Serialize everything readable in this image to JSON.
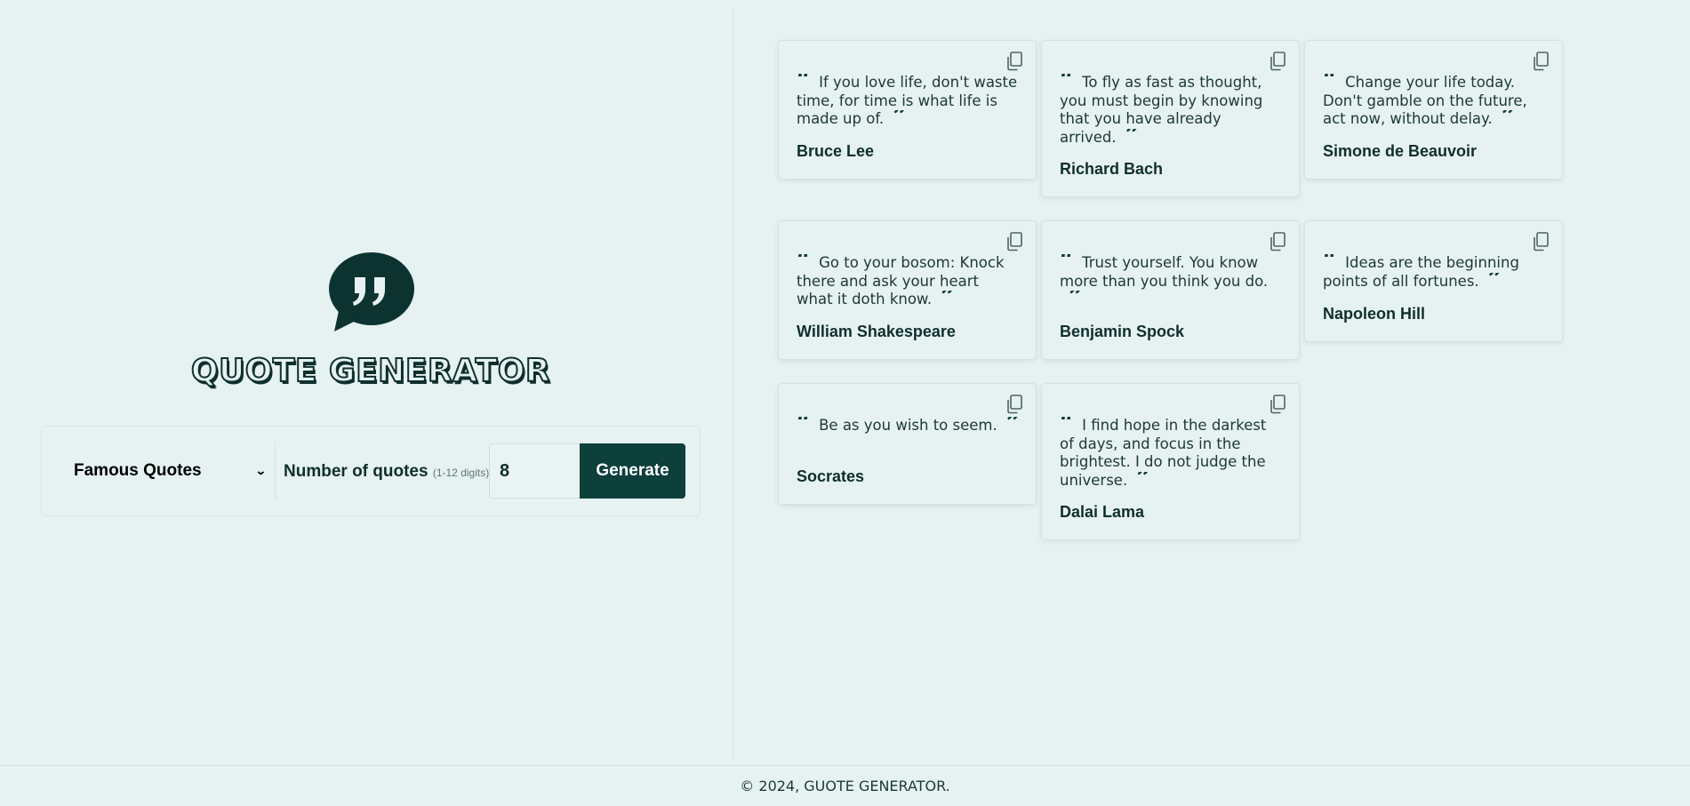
{
  "app": {
    "title": "QUOTE GENERATOR"
  },
  "controls": {
    "category": "Famous Quotes",
    "count_label": "Number of quotes",
    "count_hint": "(1-12 digits)",
    "count_value": "8",
    "generate_label": "Generate"
  },
  "quotes": [
    {
      "text": "If you love life, don't waste time, for time is what life is made up of.",
      "author": "Bruce Lee"
    },
    {
      "text": "To fly as fast as thought, you must begin by knowing that you have already arrived.",
      "author": "Richard Bach"
    },
    {
      "text": "Change your life today. Don't gamble on the future, act now, without delay.",
      "author": "Simone de Beauvoir"
    },
    {
      "text": "Go to your bosom: Knock there and ask your heart what it doth know.",
      "author": "William Shakespeare"
    },
    {
      "text": "Trust yourself. You know more than you think you do.",
      "author": "Benjamin Spock"
    },
    {
      "text": "Ideas are the beginning points of all fortunes.",
      "author": "Napoleon Hill"
    },
    {
      "text": "Be as you wish to seem.",
      "author": "Socrates"
    },
    {
      "text": "I find hope in the darkest of days, and focus in the brightest. I do not judge the universe.",
      "author": "Dalai Lama"
    }
  ],
  "icons": {
    "logo": "speech-bubble-quote-icon",
    "copy": "copy-icon",
    "open_quote": "open-quote-icon",
    "close_quote": "close-quote-icon",
    "dropdown": "chevron-down-icon"
  },
  "colors": {
    "background": "#e5f2f1",
    "accent": "#0d3f3b",
    "text": "#0f2f2d"
  },
  "footer": {
    "text": "© 2024, GUOTE GENERATOR."
  }
}
